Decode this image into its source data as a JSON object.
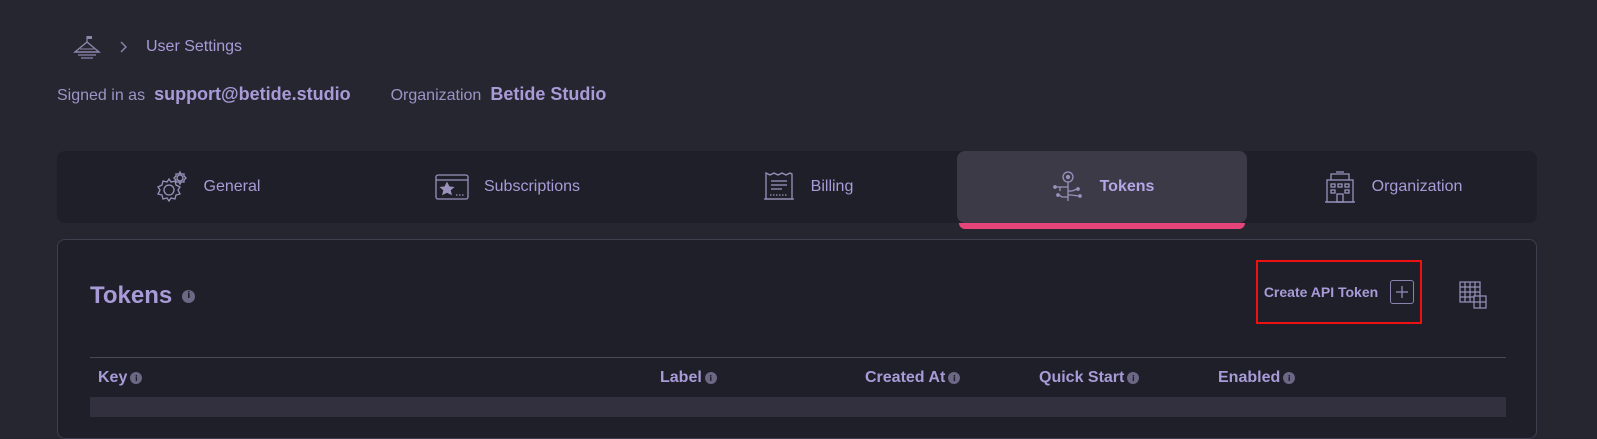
{
  "breadcrumb": {
    "logo_icon": "company-logo-icon",
    "separator_icon": "chevron-right-icon",
    "current": "User Settings"
  },
  "account": {
    "signed_in_label": "Signed in as",
    "email": "support@betide.studio",
    "org_label": "Organization",
    "org_name": "Betide Studio"
  },
  "tabs": [
    {
      "label": "General",
      "icon": "gear-icon",
      "active": false
    },
    {
      "label": "Subscriptions",
      "icon": "star-card-icon",
      "active": false
    },
    {
      "label": "Billing",
      "icon": "receipt-icon",
      "active": false
    },
    {
      "label": "Tokens",
      "icon": "key-icon",
      "active": true
    },
    {
      "label": "Organization",
      "icon": "building-icon",
      "active": false
    }
  ],
  "panel": {
    "title": "Tokens",
    "info_icon": "info-icon",
    "create_button_label": "Create API Token",
    "create_button_icon": "plus-square-icon",
    "columns_button_icon": "grid-columns-icon"
  },
  "table": {
    "columns": [
      "Key",
      "Label",
      "Created At",
      "Quick Start",
      "Enabled"
    ]
  },
  "colors": {
    "background": "#262631",
    "surface": "#1f1f29",
    "active_tab": "#3d3a48",
    "accent_underline": "#e6457a",
    "text": "#a99bd8",
    "highlight_box": "#ee1111"
  }
}
